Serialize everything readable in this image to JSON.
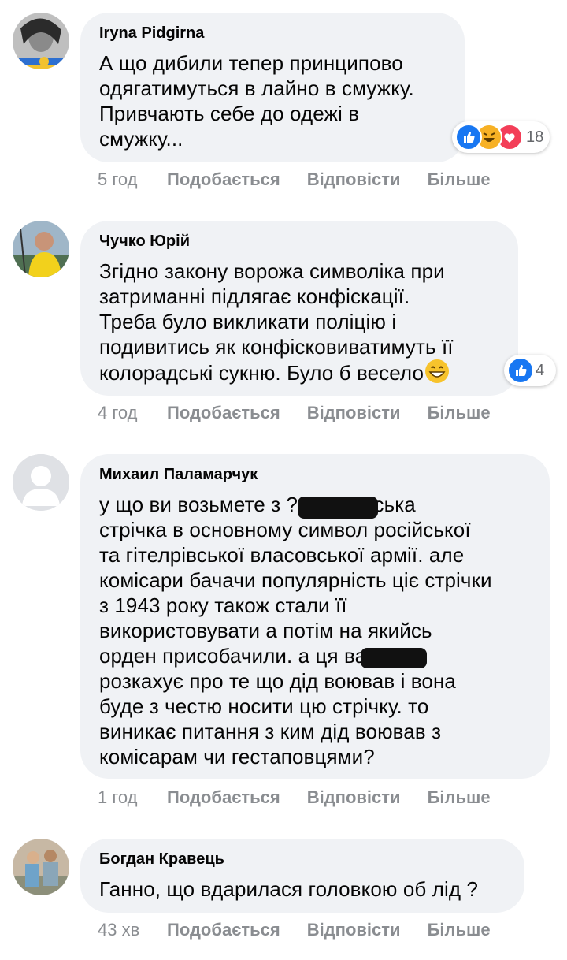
{
  "actions": {
    "like": "Подобається",
    "reply": "Відповісти",
    "more": "Більше"
  },
  "comments": [
    {
      "author": "Iryna Pidgirna",
      "text": "А що дибили тепер принципово\nодягатимуться в лайно в смужку.\nПривчають себе до одежі в\nсмужку...",
      "time": "5 год",
      "reactions": {
        "icons": [
          "like-icon",
          "haha-icon",
          "love-icon"
        ],
        "count": "18"
      }
    },
    {
      "author": "Чучко Юрій",
      "text": "Згідно закону ворожа символіка при\nзатриманні підлягає конфіскації.\nТреба було викликати поліцію і\nподивитись як конфісковиватимуть її\nколорадські сукню. Було б весело",
      "time": "4 год",
      "reactions": {
        "icons": [
          "like-icon"
        ],
        "count": "4"
      }
    },
    {
      "author": "Михаил Паламарчук",
      "text": "у що ви возьмете з          ? георгіївська\nстрічка в основному символ російської\nта гітелрівської власовської армії. але\nкомісари бачачи популярність ціє стрічки\nз 1943 року також стали її\nвикористовувати а потім на якийсь\nорден присобачили. а ця           ва\nрозкахує про те що дід воював і вона\nбуде з честю носити цю стрічку. то\nвиникає питання з ким дід воював з\nкомісарам чи гестаповцями?",
      "time": "1 год"
    },
    {
      "author": "Богдан Кравець",
      "text": "Ганно, що вдарилася головкою об лід ?",
      "time": "43 хв"
    }
  ],
  "colors": {
    "bubble": "#f0f2f5",
    "meta": "#8a8d91",
    "like_blue": "#1877f2",
    "haha_yellow": "#f7b125",
    "love_red": "#f33e58"
  }
}
